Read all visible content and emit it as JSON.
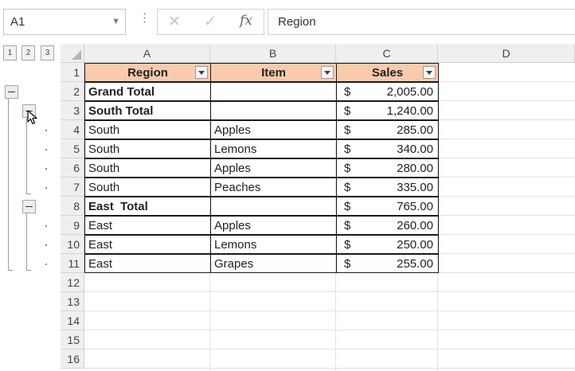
{
  "name_box": {
    "value": "A1"
  },
  "formula_bar": {
    "fx_label": "fx",
    "value": "Region"
  },
  "outline_levels": [
    "1",
    "2",
    "3"
  ],
  "columns": [
    "A",
    "B",
    "C",
    "D"
  ],
  "row_numbers": [
    "1",
    "2",
    "3",
    "4",
    "5",
    "6",
    "7",
    "8",
    "9",
    "10",
    "11",
    "12",
    "13",
    "14",
    "15",
    "16"
  ],
  "table": {
    "headers": [
      "Region",
      "Item",
      "Sales"
    ],
    "rows": [
      {
        "region": "Grand Total",
        "item": "",
        "currency": "$",
        "sales": "2,005.00",
        "bold": true
      },
      {
        "region": "South Total",
        "item": "",
        "currency": "$",
        "sales": "1,240.00",
        "bold": true
      },
      {
        "region": "South",
        "item": "Apples",
        "currency": "$",
        "sales": "285.00",
        "bold": false
      },
      {
        "region": "South",
        "item": "Lemons",
        "currency": "$",
        "sales": "340.00",
        "bold": false
      },
      {
        "region": "South",
        "item": "Apples",
        "currency": "$",
        "sales": "280.00",
        "bold": false
      },
      {
        "region": "South",
        "item": "Peaches",
        "currency": "$",
        "sales": "335.00",
        "bold": false
      },
      {
        "region": "East  Total",
        "item": "",
        "currency": "$",
        "sales": "765.00",
        "bold": true
      },
      {
        "region": "East",
        "item": "Apples",
        "currency": "$",
        "sales": "260.00",
        "bold": false
      },
      {
        "region": "East",
        "item": "Lemons",
        "currency": "$",
        "sales": "250.00",
        "bold": false
      },
      {
        "region": "East",
        "item": "Grapes",
        "currency": "$",
        "sales": "255.00",
        "bold": false
      }
    ]
  },
  "colors": {
    "header_fill": "#f8cbad",
    "grid_border": "#1a1a1a"
  },
  "icons": [
    "cancel-icon",
    "enter-icon",
    "function-icon",
    "filter-dropdown-icon",
    "collapse-icon",
    "mouse-cursor-icon"
  ]
}
